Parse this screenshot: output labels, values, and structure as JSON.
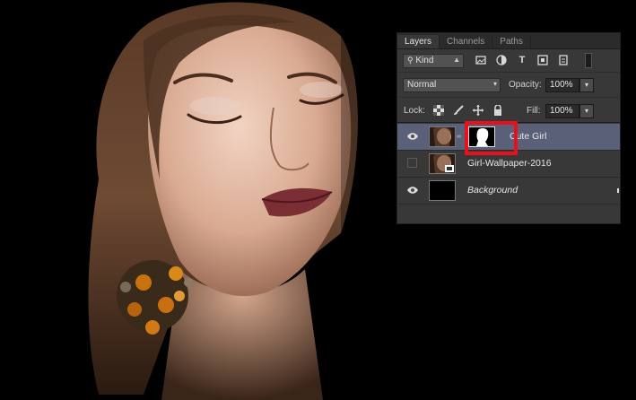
{
  "panel": {
    "tabs": [
      {
        "label": "Layers",
        "active": true
      },
      {
        "label": "Channels",
        "active": false
      },
      {
        "label": "Paths",
        "active": false
      }
    ],
    "filter": {
      "kind_label": "Kind",
      "icons": [
        "image-filter-icon",
        "adjustment-filter-icon",
        "type-filter-icon",
        "shape-filter-icon",
        "smart-object-filter-icon"
      ]
    },
    "blend_mode": "Normal",
    "opacity_label": "Opacity:",
    "opacity_value": "100%",
    "lock_label": "Lock:",
    "fill_label": "Fill:",
    "fill_value": "100%",
    "layers": [
      {
        "name": "Cute Girl",
        "visible": true,
        "selected": true,
        "has_mask": true
      },
      {
        "name": "Girl-Wallpaper-2016",
        "visible": false,
        "selected": false,
        "has_mask": false
      },
      {
        "name": "Background",
        "visible": true,
        "selected": false,
        "italic": true
      }
    ]
  },
  "colors": {
    "highlight": "#e8101c",
    "selected_row": "#5a6077",
    "panel_bg": "#383838"
  }
}
